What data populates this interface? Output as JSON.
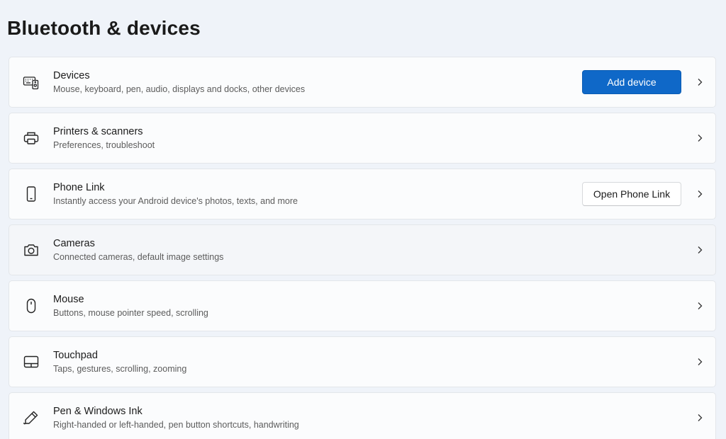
{
  "header": {
    "title": "Bluetooth & devices"
  },
  "colors": {
    "accent": "#0f68c8",
    "background": "#eff3f9",
    "card": "#fbfcfd"
  },
  "items": [
    {
      "key": "devices",
      "icon": "keyboard-icon",
      "name": "Devices",
      "desc": "Mouse, keyboard, pen, audio, displays and docks, other devices",
      "button": "Add device"
    },
    {
      "key": "printers",
      "icon": "printer-icon",
      "name": "Printers & scanners",
      "desc": "Preferences, troubleshoot"
    },
    {
      "key": "phone-link",
      "icon": "phone-icon",
      "name": "Phone Link",
      "desc": "Instantly access your Android device's photos, texts, and more",
      "button": "Open Phone Link"
    },
    {
      "key": "cameras",
      "icon": "camera-icon",
      "name": "Cameras",
      "desc": "Connected cameras, default image settings"
    },
    {
      "key": "mouse",
      "icon": "mouse-icon",
      "name": "Mouse",
      "desc": "Buttons, mouse pointer speed, scrolling"
    },
    {
      "key": "touchpad",
      "icon": "touchpad-icon",
      "name": "Touchpad",
      "desc": "Taps, gestures, scrolling, zooming"
    },
    {
      "key": "pen",
      "icon": "pen-icon",
      "name": "Pen & Windows Ink",
      "desc": "Right-handed or left-handed, pen button shortcuts, handwriting"
    }
  ]
}
